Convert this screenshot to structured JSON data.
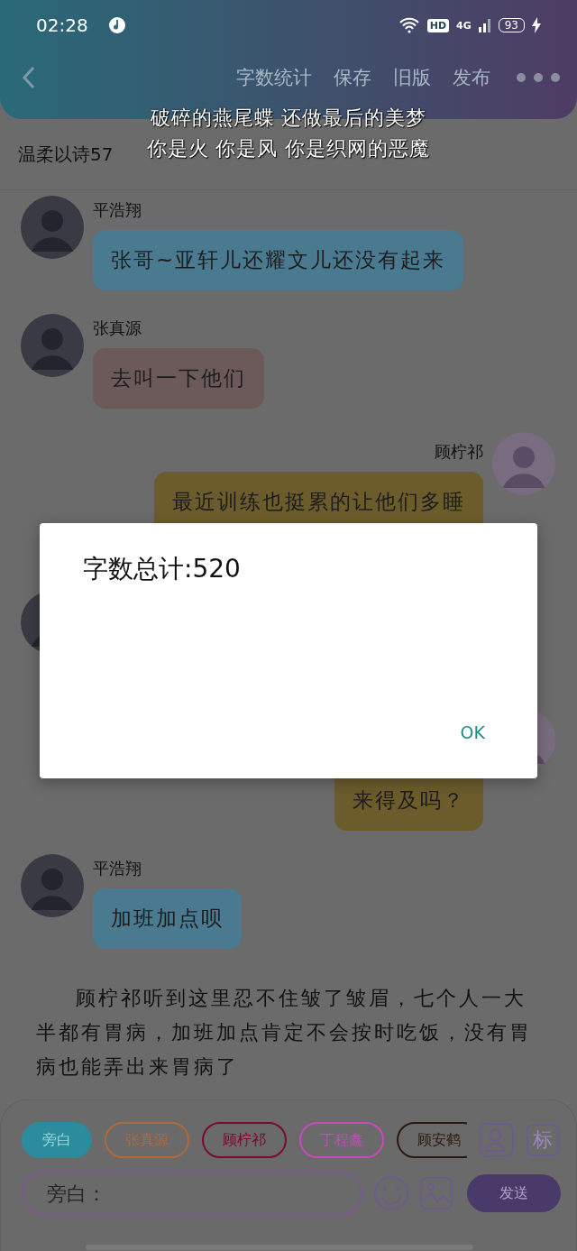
{
  "status_bar": {
    "time": "02:28",
    "hd": "HD",
    "network": "4G",
    "battery": "93"
  },
  "toolbar": {
    "actions": [
      {
        "label": "字数统计"
      },
      {
        "label": "保存"
      },
      {
        "label": "旧版"
      },
      {
        "label": "发布"
      }
    ]
  },
  "story_title": "温柔以诗57",
  "caption_overlay": [
    "破碎的燕尾蝶 还做最后的美梦",
    "你是火 你是风 你是织网的恶魔"
  ],
  "messages": [
    {
      "outgoing": false,
      "name": "平浩翔",
      "text": "张哥~亚轩儿还耀文儿还没有起来",
      "color": "#4a7a90"
    },
    {
      "outgoing": false,
      "name": "张真源",
      "text": "去叫一下他们",
      "color": "#6c5a5a"
    },
    {
      "outgoing": true,
      "name": "顾柠祁",
      "text": "最近训练也挺累的让他们多睡",
      "color": "#6c5c2c",
      "kind": "cut_below"
    },
    {
      "outgoing": false,
      "kind": "covered"
    },
    {
      "outgoing": true,
      "text": "来得及吗？",
      "color": "#6c5c2c",
      "kind": "cut_above"
    },
    {
      "outgoing": false,
      "name": "平浩翔",
      "text": "加班加点呗",
      "color": "#4a7a90"
    }
  ],
  "narration": "顾柠祁听到这里忍不住皱了皱眉，七个人一大半都有胃病，加班加点肯定不会按时吃饭，没有胃病也能弄出来胃病了",
  "roles": [
    {
      "label": "旁白",
      "selected": true,
      "color": "#2a8c9c"
    },
    {
      "label": "张真源",
      "selected": false,
      "color": "#b06a3a"
    },
    {
      "label": "顾柠祁",
      "selected": false,
      "color": "#7a0a30"
    },
    {
      "label": "丁程鑫",
      "selected": false,
      "color": "#c44cbc"
    },
    {
      "label": "顾安鹤",
      "selected": false,
      "color": "#2a1a12"
    }
  ],
  "tag_button": "标",
  "input": {
    "placeholder": "旁白："
  },
  "send_button": "发送",
  "dialog": {
    "message": "字数总计:520",
    "button": "OK"
  }
}
